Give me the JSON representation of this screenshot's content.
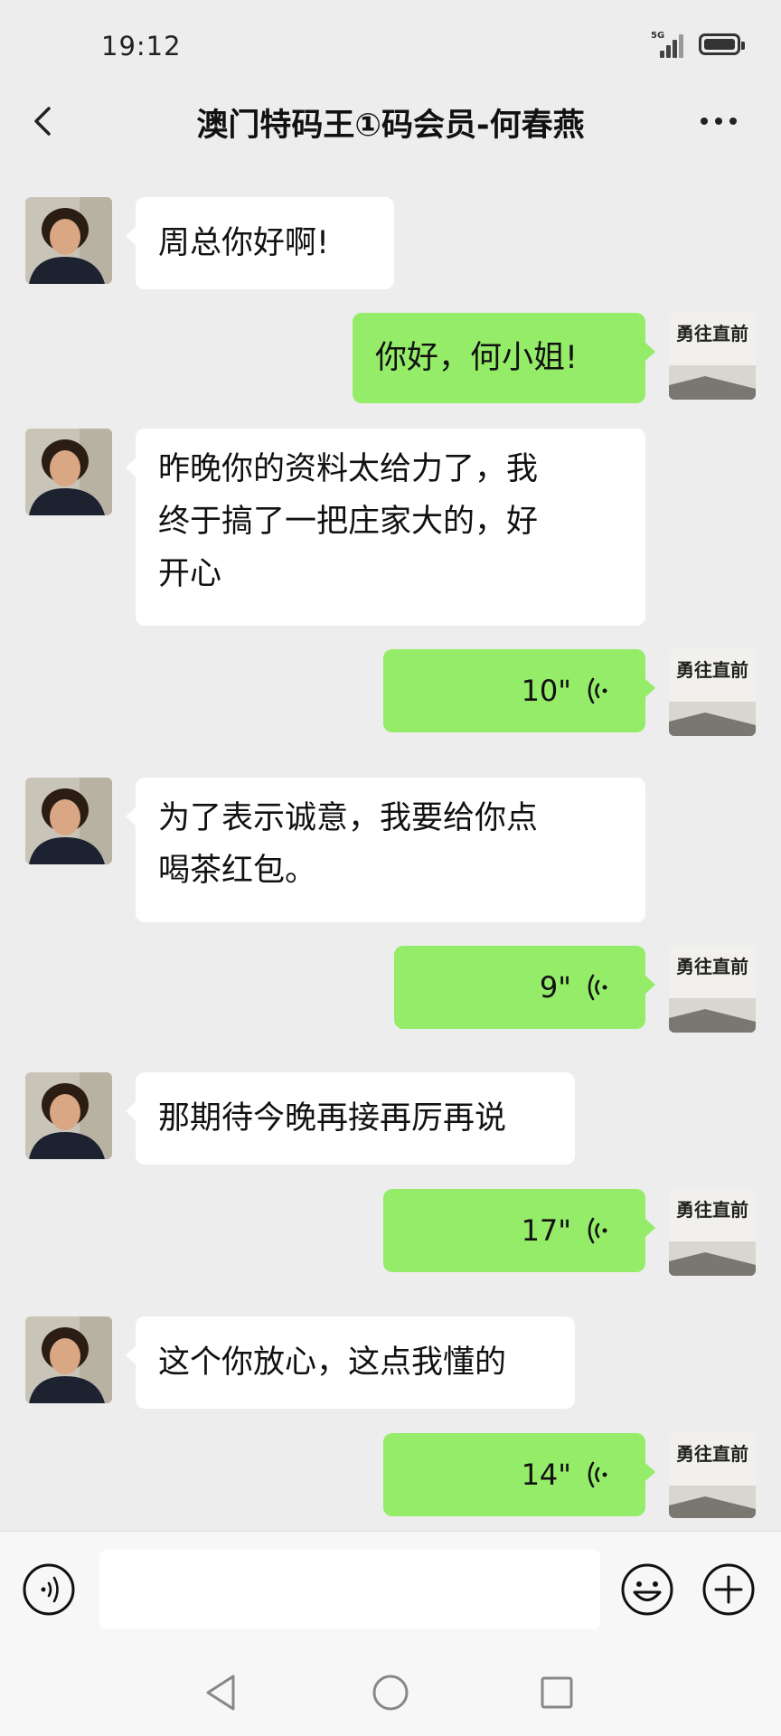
{
  "status": {
    "time": "19:12",
    "network": "5G"
  },
  "header": {
    "title": "澳门特码王①码会员-何春燕"
  },
  "messages": [
    {
      "side": "in",
      "text": "周总你好啊!"
    },
    {
      "side": "out",
      "text": "你好，何小姐!"
    },
    {
      "side": "in",
      "lines": [
        "昨晚你的资料太给力了，我",
        "终于搞了一把庄家大的，好",
        "开心"
      ]
    },
    {
      "side": "out",
      "type": "voice",
      "duration": "10\""
    },
    {
      "side": "in",
      "lines": [
        "为了表示诚意，我要给你点",
        "喝茶红包。"
      ]
    },
    {
      "side": "out",
      "type": "voice",
      "duration": "9\""
    },
    {
      "side": "in",
      "text": "那期待今晚再接再厉再说"
    },
    {
      "side": "out",
      "type": "voice",
      "duration": "17\""
    },
    {
      "side": "in",
      "text": "这个你放心，这点我懂的"
    },
    {
      "side": "out",
      "type": "voice",
      "duration": "14\""
    }
  ],
  "avatar_other": {
    "description": "photo-avatar",
    "colors": {
      "bg": "#c9c4b8",
      "hair": "#2b1d14",
      "skin": "#d9a784",
      "shirt": "#1c2230"
    }
  },
  "avatar_self": {
    "text": "勇往直前"
  },
  "input": {
    "value": "",
    "placeholder": ""
  },
  "icons": {
    "back": "chevron-left-icon",
    "more": "more-dots-icon",
    "voice_input": "voice-input-icon",
    "emoji": "emoji-icon",
    "plus": "plus-icon",
    "voice_wave": "voice-wave-icon",
    "nav_back": "nav-back-icon",
    "nav_home": "nav-home-icon",
    "nav_recent": "nav-recent-icon"
  },
  "colors": {
    "background": "#ededed",
    "bubble_out": "#95ec69",
    "bubble_in": "#ffffff"
  }
}
